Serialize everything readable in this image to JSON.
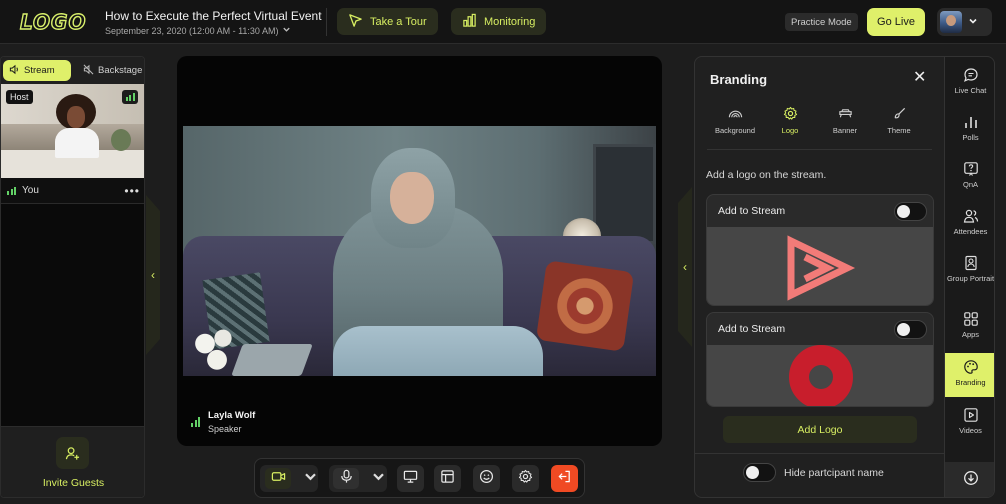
{
  "header": {
    "logo_text": "LOGO",
    "event_title": "How to Execute the Perfect Virtual Event",
    "event_date": "September 23, 2020 (12:00 AM - 11:30 AM)",
    "take_tour_label": "Take a Tour",
    "monitoring_label": "Monitoring",
    "practice_mode_label": "Practice Mode",
    "go_live_label": "Go Live"
  },
  "left_panel": {
    "tabs": [
      {
        "label": "Stream",
        "icon": "speaker-icon",
        "active": true
      },
      {
        "label": "Backstage",
        "icon": "speaker-muted-icon",
        "active": false
      }
    ],
    "host_badge": "Host",
    "self_label": "You",
    "more_label": "•••",
    "invite_label": "Invite Guests"
  },
  "stage": {
    "speaker_name": "Layla Wolf",
    "speaker_role": "Speaker"
  },
  "branding": {
    "title": "Branding",
    "close_label": "✕",
    "tabs": [
      {
        "label": "Background",
        "icon": "rainbow-icon",
        "active": false
      },
      {
        "label": "Logo",
        "icon": "gear-badge-icon",
        "active": true
      },
      {
        "label": "Banner",
        "icon": "banner-icon",
        "active": false
      },
      {
        "label": "Theme",
        "icon": "brush-icon",
        "active": false
      }
    ],
    "description": "Add a logo on the stream.",
    "cards": [
      {
        "label": "Add to Stream",
        "enabled": false,
        "logo_color": "#f27b78"
      },
      {
        "label": "Add to Stream",
        "enabled": false,
        "logo_color": "#c81e2c"
      }
    ],
    "add_logo_label": "Add Logo",
    "hide_participant_label": "Hide partcipant name"
  },
  "rail": {
    "items": [
      {
        "label": "Live Chat",
        "icon": "chat-icon"
      },
      {
        "label": "Polls",
        "icon": "bar-chart-icon"
      },
      {
        "label": "QnA",
        "icon": "question-icon"
      },
      {
        "label": "Attendees",
        "icon": "users-icon"
      },
      {
        "label": "Group Portrait",
        "icon": "portrait-icon"
      },
      {
        "label": "Apps",
        "icon": "apps-grid-icon"
      },
      {
        "label": "Branding",
        "icon": "palette-icon",
        "active": true
      },
      {
        "label": "Videos",
        "icon": "video-file-icon"
      }
    ]
  },
  "colors": {
    "accent": "#dff06a",
    "accent_dark": "#2a2d1e",
    "leave": "#f04a23",
    "signal": "#63d267"
  }
}
